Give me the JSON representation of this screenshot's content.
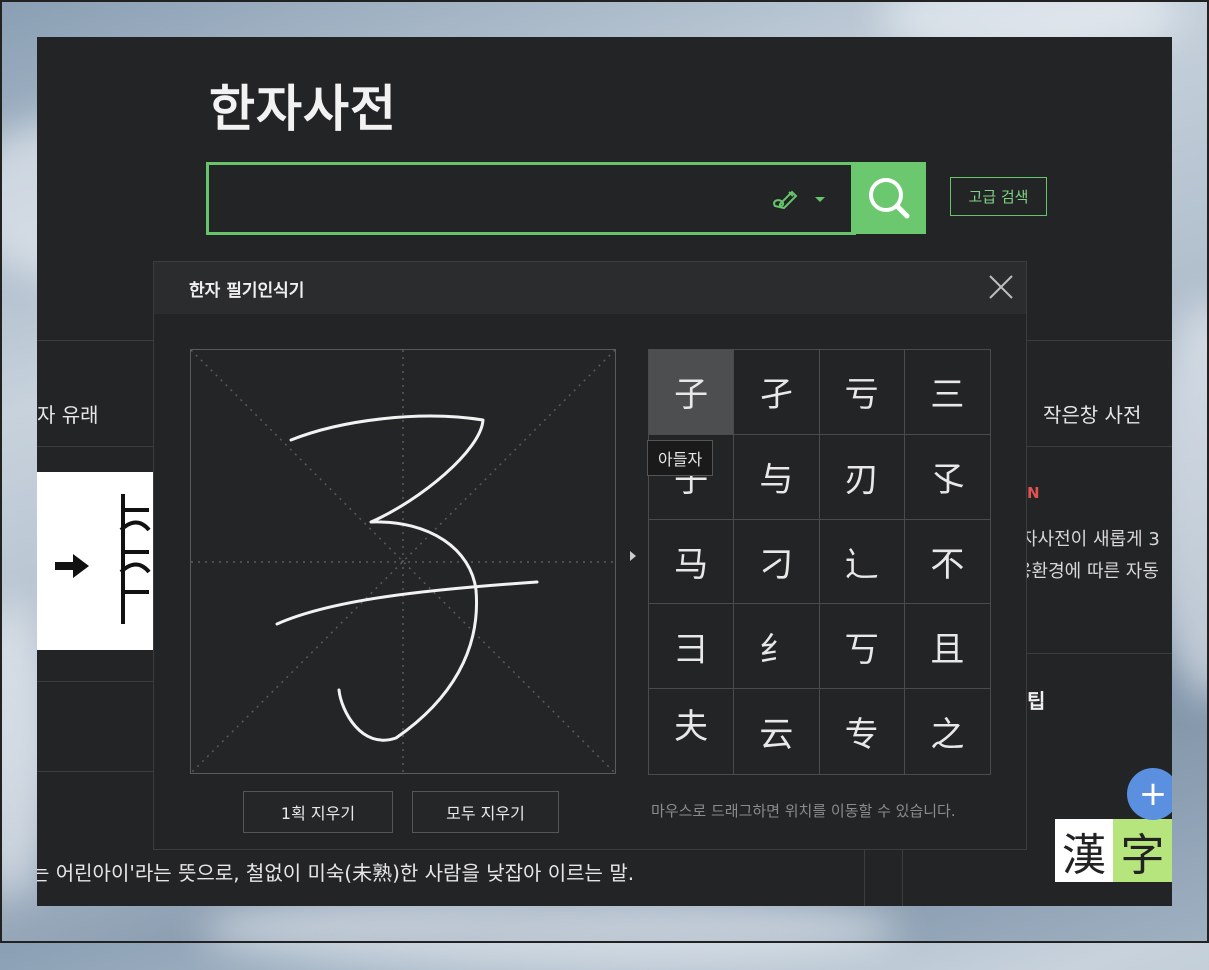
{
  "header": {
    "title": "한자사전",
    "search_placeholder": "",
    "advanced_search": "고급 검색"
  },
  "left": {
    "tab_origin": "자 유래",
    "meaning_text": "는 어린아이'라는 뜻으로, 철없이 미숙(未熟)한 사람을 낮잡아 이르는 말."
  },
  "right": {
    "tab_mini": "작은창 사전",
    "notice_tag": "N",
    "notice_line1": "자사전이 새롭게 3",
    "notice_line2": "용환경에 따른 자동",
    "tip": "팁",
    "logo_chars": [
      "漢",
      "字"
    ],
    "plus_icon": "+"
  },
  "modal": {
    "title": "한자 필기인식기",
    "candidates": [
      "子",
      "孑",
      "亏",
      "三",
      "子",
      "与",
      "刃",
      "孓",
      "马",
      "刁",
      "辶",
      "不",
      "彐",
      "纟",
      "丂",
      "且",
      "夫",
      "云",
      "专",
      "之"
    ],
    "tooltip": "아들자",
    "erase_one": "1획 지우기",
    "erase_all": "모두 지우기",
    "drag_hint": "마우스로 드래그하면 위치를 이동할 수 있습니다."
  },
  "colors": {
    "accent_green": "#6cc86f",
    "background": "#232426",
    "notice_red": "#e0514f",
    "plus_blue": "#5b8fe0"
  }
}
